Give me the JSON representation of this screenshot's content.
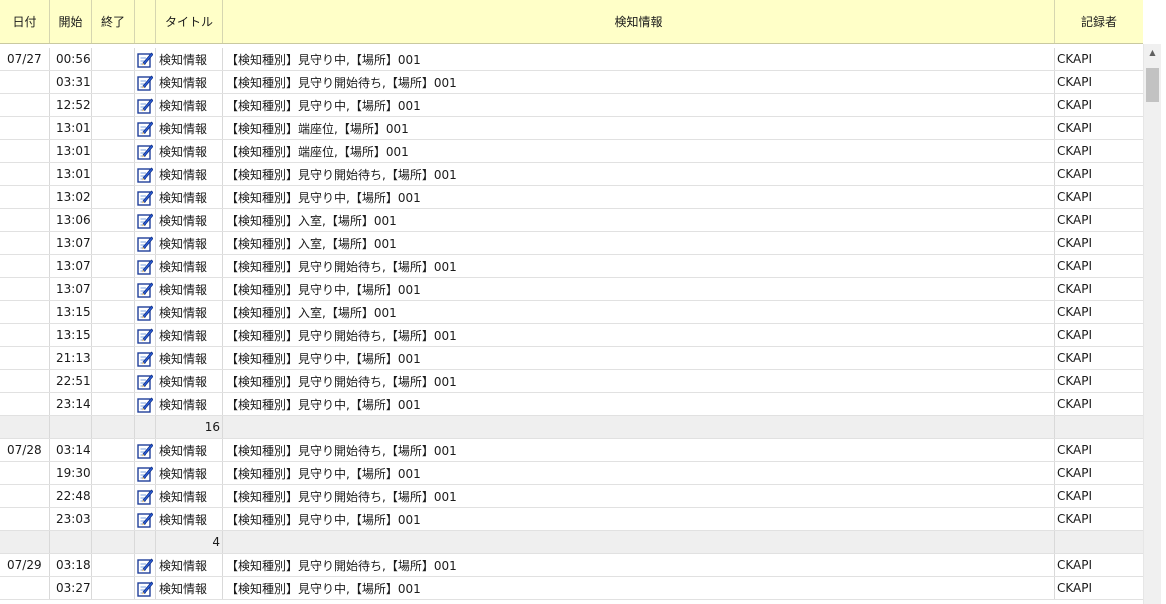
{
  "header": {
    "date": "日付",
    "start": "開始",
    "end": "終了",
    "icon": "",
    "title": "タイトル",
    "info": "検知情報",
    "recorder": "記録者"
  },
  "colors": {
    "header_bg": "#ffffc8",
    "summary_bg": "#efefef",
    "grid": "#d9d9d9"
  },
  "icons": {
    "row_icon": "memo-pencil-icon",
    "scroll_up": "chevron-up-icon"
  },
  "rows": [
    {
      "type": "data",
      "date": "07/27",
      "start": "00:56",
      "end": "",
      "title": "検知情報",
      "info": "【検知種別】見守り中,【場所】001",
      "recorder": "CKAPI"
    },
    {
      "type": "data",
      "date": "",
      "start": "03:31",
      "end": "",
      "title": "検知情報",
      "info": "【検知種別】見守り開始待ち,【場所】001",
      "recorder": "CKAPI"
    },
    {
      "type": "data",
      "date": "",
      "start": "12:52",
      "end": "",
      "title": "検知情報",
      "info": "【検知種別】見守り中,【場所】001",
      "recorder": "CKAPI"
    },
    {
      "type": "data",
      "date": "",
      "start": "13:01",
      "end": "",
      "title": "検知情報",
      "info": "【検知種別】端座位,【場所】001",
      "recorder": "CKAPI"
    },
    {
      "type": "data",
      "date": "",
      "start": "13:01",
      "end": "",
      "title": "検知情報",
      "info": "【検知種別】端座位,【場所】001",
      "recorder": "CKAPI"
    },
    {
      "type": "data",
      "date": "",
      "start": "13:01",
      "end": "",
      "title": "検知情報",
      "info": "【検知種別】見守り開始待ち,【場所】001",
      "recorder": "CKAPI"
    },
    {
      "type": "data",
      "date": "",
      "start": "13:02",
      "end": "",
      "title": "検知情報",
      "info": "【検知種別】見守り中,【場所】001",
      "recorder": "CKAPI"
    },
    {
      "type": "data",
      "date": "",
      "start": "13:06",
      "end": "",
      "title": "検知情報",
      "info": "【検知種別】入室,【場所】001",
      "recorder": "CKAPI"
    },
    {
      "type": "data",
      "date": "",
      "start": "13:07",
      "end": "",
      "title": "検知情報",
      "info": "【検知種別】入室,【場所】001",
      "recorder": "CKAPI"
    },
    {
      "type": "data",
      "date": "",
      "start": "13:07",
      "end": "",
      "title": "検知情報",
      "info": "【検知種別】見守り開始待ち,【場所】001",
      "recorder": "CKAPI"
    },
    {
      "type": "data",
      "date": "",
      "start": "13:07",
      "end": "",
      "title": "検知情報",
      "info": "【検知種別】見守り中,【場所】001",
      "recorder": "CKAPI"
    },
    {
      "type": "data",
      "date": "",
      "start": "13:15",
      "end": "",
      "title": "検知情報",
      "info": "【検知種別】入室,【場所】001",
      "recorder": "CKAPI"
    },
    {
      "type": "data",
      "date": "",
      "start": "13:15",
      "end": "",
      "title": "検知情報",
      "info": "【検知種別】見守り開始待ち,【場所】001",
      "recorder": "CKAPI"
    },
    {
      "type": "data",
      "date": "",
      "start": "21:13",
      "end": "",
      "title": "検知情報",
      "info": "【検知種別】見守り中,【場所】001",
      "recorder": "CKAPI"
    },
    {
      "type": "data",
      "date": "",
      "start": "22:51",
      "end": "",
      "title": "検知情報",
      "info": "【検知種別】見守り開始待ち,【場所】001",
      "recorder": "CKAPI"
    },
    {
      "type": "data",
      "date": "",
      "start": "23:14",
      "end": "",
      "title": "検知情報",
      "info": "【検知種別】見守り中,【場所】001",
      "recorder": "CKAPI"
    },
    {
      "type": "summary",
      "count": "16"
    },
    {
      "type": "data",
      "date": "07/28",
      "start": "03:14",
      "end": "",
      "title": "検知情報",
      "info": "【検知種別】見守り開始待ち,【場所】001",
      "recorder": "CKAPI"
    },
    {
      "type": "data",
      "date": "",
      "start": "19:30",
      "end": "",
      "title": "検知情報",
      "info": "【検知種別】見守り中,【場所】001",
      "recorder": "CKAPI"
    },
    {
      "type": "data",
      "date": "",
      "start": "22:48",
      "end": "",
      "title": "検知情報",
      "info": "【検知種別】見守り開始待ち,【場所】001",
      "recorder": "CKAPI"
    },
    {
      "type": "data",
      "date": "",
      "start": "23:03",
      "end": "",
      "title": "検知情報",
      "info": "【検知種別】見守り中,【場所】001",
      "recorder": "CKAPI"
    },
    {
      "type": "summary",
      "count": "4"
    },
    {
      "type": "data",
      "date": "07/29",
      "start": "03:18",
      "end": "",
      "title": "検知情報",
      "info": "【検知種別】見守り開始待ち,【場所】001",
      "recorder": "CKAPI"
    },
    {
      "type": "data",
      "date": "",
      "start": "03:27",
      "end": "",
      "title": "検知情報",
      "info": "【検知種別】見守り中,【場所】001",
      "recorder": "CKAPI"
    }
  ]
}
